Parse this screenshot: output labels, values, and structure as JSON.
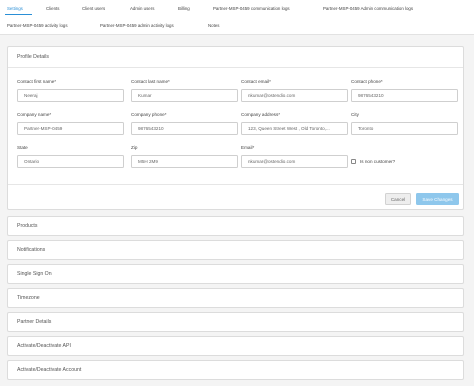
{
  "tabs": [
    {
      "label": "Settings"
    },
    {
      "label": "Clients"
    },
    {
      "label": "Client users"
    },
    {
      "label": "Admin users"
    },
    {
      "label": "Billing"
    },
    {
      "label": "Partner-MSP-0459 communication logs"
    },
    {
      "label": "Partner-MSP-0459 Admin communication logs"
    },
    {
      "label": "Partner-MSP-0459 activity logs"
    },
    {
      "label": "Partner-MSP-0459 admin activity logs"
    },
    {
      "label": "Notes"
    }
  ],
  "profile": {
    "title": "Profile Details",
    "fields": {
      "first_name": {
        "label": "Contact first name*",
        "value": "Neeraj"
      },
      "last_name": {
        "label": "Contact last name*",
        "value": "Kumar"
      },
      "email": {
        "label": "Contact email*",
        "value": "nkumar@ostendio.com"
      },
      "phone": {
        "label": "Contact phone*",
        "value": "9876543210"
      },
      "company_name": {
        "label": "Company name*",
        "value": "Partner-MSP-0459"
      },
      "company_phone": {
        "label": "Company phone*",
        "value": "9876543210"
      },
      "company_address": {
        "label": "Company address*",
        "value": "123, Queen Street West , Old Toronto,..."
      },
      "city": {
        "label": "City",
        "value": "Toronto"
      },
      "state": {
        "label": "State",
        "value": "Ontario"
      },
      "zip": {
        "label": "Zip",
        "value": "M5H 2M9"
      },
      "email2": {
        "label": "Email*",
        "value": "nkumar@ostendio.com"
      }
    },
    "non_customer_label": "Is non customer?",
    "non_customer_checked": false,
    "cancel_label": "Cancel",
    "save_label": "Save Changes"
  },
  "sections": [
    {
      "label": "Products"
    },
    {
      "label": "Notifications"
    },
    {
      "label": "Single Sign On"
    },
    {
      "label": "Timezone"
    },
    {
      "label": "Partner Details"
    },
    {
      "label": "Activate/Deactivate API"
    },
    {
      "label": "Activate/Deactivate Account"
    }
  ],
  "colors": {
    "accent": "#2a8fd6",
    "save_button": "#8ec7ec"
  }
}
